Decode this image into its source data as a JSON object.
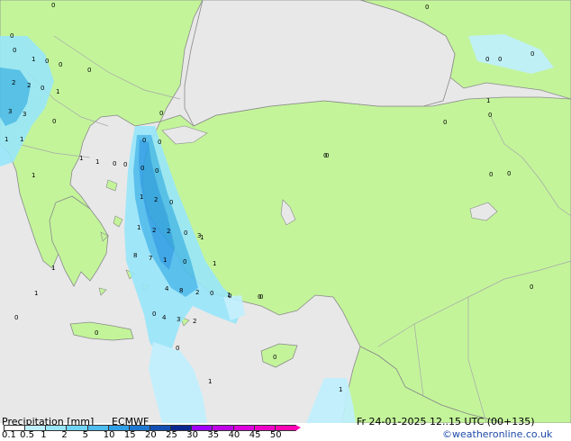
{
  "footer": {
    "title": "Precipitation [mm]",
    "model": "ECMWF",
    "valid_time": "Fr 24-01-2025 12..15 UTC (00+135)",
    "credit": "©weatheronline.co.uk"
  },
  "legend": {
    "ticks": [
      "0.1",
      "0.5",
      "1",
      "2",
      "5",
      "10",
      "15",
      "20",
      "25",
      "30",
      "35",
      "40",
      "45",
      "50"
    ],
    "colors": [
      "#ffffff",
      "#bff0ff",
      "#99e6fb",
      "#6fd4f5",
      "#4dbcee",
      "#2fa0e6",
      "#1e78d2",
      "#1450b4",
      "#0a2890",
      "#a000ff",
      "#c000e6",
      "#dc00dc",
      "#f000c8",
      "#ff00b4"
    ]
  },
  "colors": {
    "land": "#c3f49a",
    "sea": "#e8e8e8",
    "border": "#a8a8a8",
    "coast": "#8a8a8a"
  },
  "map_labels": [
    "0",
    "0",
    "1",
    "0",
    "0",
    "0",
    "0",
    "2",
    "2",
    "0",
    "1",
    "3",
    "3",
    "0",
    "1",
    "1",
    "0",
    "0",
    "0",
    "1",
    "1",
    "0",
    "0",
    "0",
    "0",
    "1",
    "1",
    "2",
    "0",
    "3",
    "1",
    "2",
    "2",
    "0",
    "1",
    "8",
    "7",
    "1",
    "0",
    "1",
    "4",
    "8",
    "2",
    "0",
    "1",
    "4",
    "3",
    "2",
    "0",
    "1",
    "0",
    "1",
    "1",
    "1",
    "0",
    "0",
    "0",
    "0",
    "0",
    "0",
    "0",
    "0",
    "1",
    "0",
    "0",
    "0",
    "0",
    "0",
    "0",
    "0",
    "0",
    "0"
  ]
}
